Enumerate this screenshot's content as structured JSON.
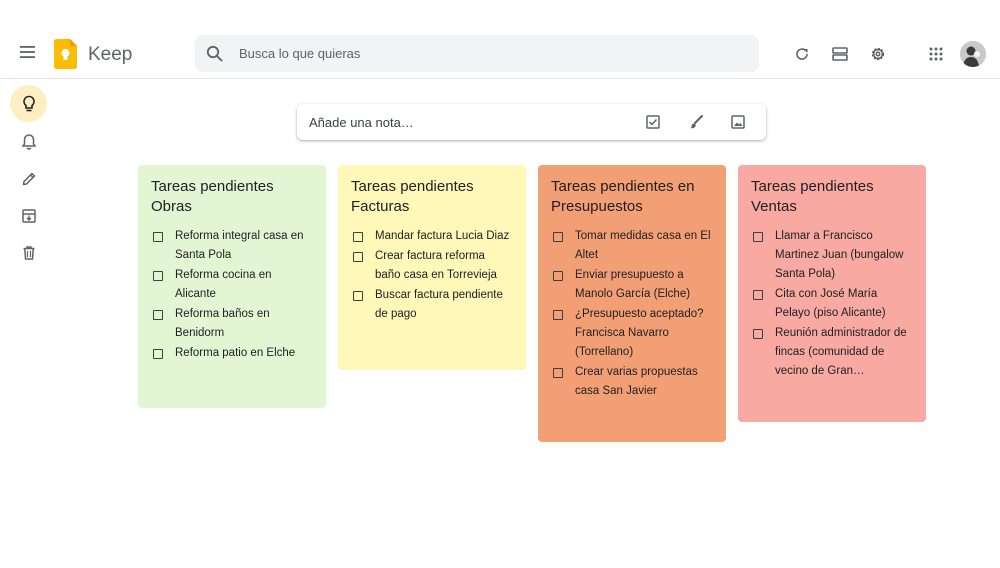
{
  "header": {
    "app_title": "Keep",
    "search_placeholder": "Busca lo que quieras",
    "icons": [
      "menu-icon",
      "refresh-icon",
      "list-view-icon",
      "settings-icon",
      "apps-icon",
      "avatar"
    ]
  },
  "sidebar": {
    "items": [
      {
        "icon": "lightbulb-icon",
        "active": true
      },
      {
        "icon": "bell-icon",
        "active": false
      },
      {
        "icon": "pencil-icon",
        "active": false
      },
      {
        "icon": "archive-icon",
        "active": false
      },
      {
        "icon": "trash-icon",
        "active": false
      }
    ]
  },
  "take_note": {
    "placeholder": "Añade una nota…",
    "icons": [
      "checkbox-icon",
      "brush-icon",
      "image-icon"
    ]
  },
  "notes": [
    {
      "title": "Tareas pendientes Obras",
      "color": "#e2f6d3",
      "items": [
        "Reforma integral casa en Santa Pola",
        "Reforma cocina en Alicante",
        "Reforma baños en Benidorm",
        "Reforma patio en Elche"
      ]
    },
    {
      "title": "Tareas pendientes Facturas",
      "color": "#fff8b8",
      "items": [
        "Mandar factura Lucia Diaz",
        "Crear factura reforma baño casa en Torrevieja",
        "Buscar factura pendiente de pago"
      ]
    },
    {
      "title": "Tareas pendientes en Presupuestos",
      "color": "#f39f76",
      "items": [
        "Tomar medidas casa en El Altet",
        "Enviar presupuesto a Manolo García (Elche)",
        "¿Presupuesto aceptado? Francisca Navarro (Torrellano)",
        "Crear varias propuestas casa San Javier"
      ]
    },
    {
      "title": "Tareas pendientes Ventas",
      "color": "#f8a9a2",
      "items": [
        "Llamar a Francisco Martinez Juan (bungalow Santa Pola)",
        "Cita con José María Pelayo (piso Alicante)",
        "Reunión administrador de fincas (comunidad de vecino de Gran…"
      ]
    }
  ]
}
